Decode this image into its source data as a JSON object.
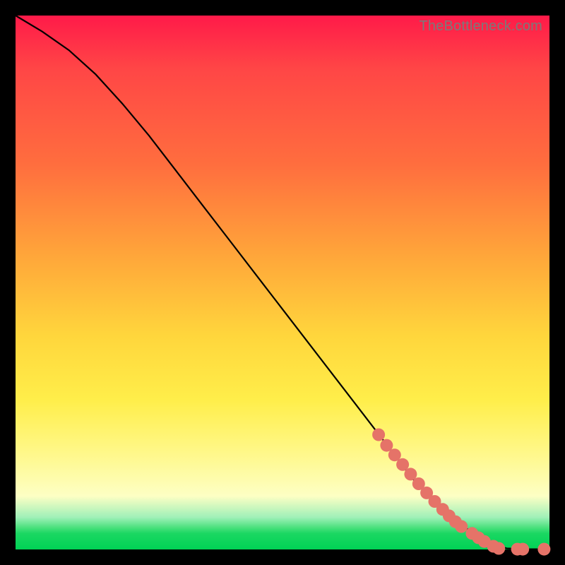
{
  "watermark": "TheBottleneck.com",
  "chart_data": {
    "type": "line",
    "title": "",
    "xlabel": "",
    "ylabel": "",
    "xlim": [
      0,
      100
    ],
    "ylim": [
      0,
      100
    ],
    "grid": false,
    "legend": false,
    "series": [
      {
        "name": "main-curve",
        "x": [
          0,
          5,
          10,
          15,
          20,
          25,
          30,
          35,
          40,
          45,
          50,
          55,
          60,
          65,
          70,
          73,
          75,
          78,
          80,
          82,
          84,
          86,
          87.5,
          89,
          90.5,
          92,
          96,
          100
        ],
        "y": [
          100,
          97,
          93.5,
          89,
          83.5,
          77.5,
          71,
          64.5,
          58,
          51.5,
          45,
          38.5,
          32,
          25.5,
          19,
          15,
          12.5,
          9.5,
          7.5,
          5.8,
          4.2,
          3,
          2,
          1.2,
          0.6,
          0.2,
          0.05,
          0.05
        ]
      }
    ],
    "markers": {
      "name": "highlighted-points",
      "comment": "salmon dots clustered along lower-right of curve and along x-axis tail",
      "x": [
        68,
        69.5,
        71,
        72.5,
        74,
        75.5,
        77,
        78.5,
        80,
        81.2,
        82.4,
        83.5,
        85.5,
        86.7,
        87.8,
        89.5,
        90.5,
        94,
        95,
        99
      ],
      "y": [
        21.5,
        19.5,
        17.7,
        15.9,
        14.1,
        12.3,
        10.6,
        9,
        7.5,
        6.3,
        5.2,
        4.3,
        3,
        2.2,
        1.5,
        0.6,
        0.2,
        0.05,
        0.05,
        0.05
      ]
    },
    "background_gradient_stops": [
      {
        "pos": 0.0,
        "color": "#ff1a49"
      },
      {
        "pos": 0.28,
        "color": "#ff6e3e"
      },
      {
        "pos": 0.6,
        "color": "#ffd63c"
      },
      {
        "pos": 0.9,
        "color": "#fdffc4"
      },
      {
        "pos": 0.96,
        "color": "#46e07a"
      },
      {
        "pos": 1.0,
        "color": "#00d255"
      }
    ]
  }
}
